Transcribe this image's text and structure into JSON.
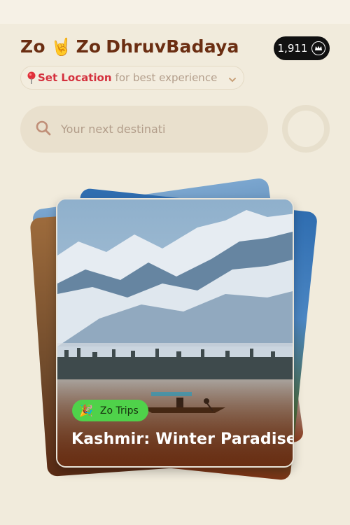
{
  "header": {
    "greeting_a": "Zo",
    "greeting_emoji": "🤘",
    "greeting_b": "Zo",
    "username": "DhruvBadaya"
  },
  "points": {
    "value": "1,911",
    "icon": "crown-coin-icon"
  },
  "location": {
    "pin": "📍",
    "cta": "Set Location",
    "rest": "for best experience",
    "icon": "chevron-down-icon"
  },
  "search": {
    "placeholder": "Your next destinati",
    "value": ""
  },
  "card": {
    "tag_emoji": "🎉",
    "tag_label": "Zo Trips",
    "title": "Kashmir: Winter Paradise"
  },
  "colors": {
    "background": "#f1ebdc",
    "brand_text": "#6b2e12",
    "accent_red": "#d4303d",
    "tag_green": "#4fd24a",
    "points_bg": "#111111"
  }
}
